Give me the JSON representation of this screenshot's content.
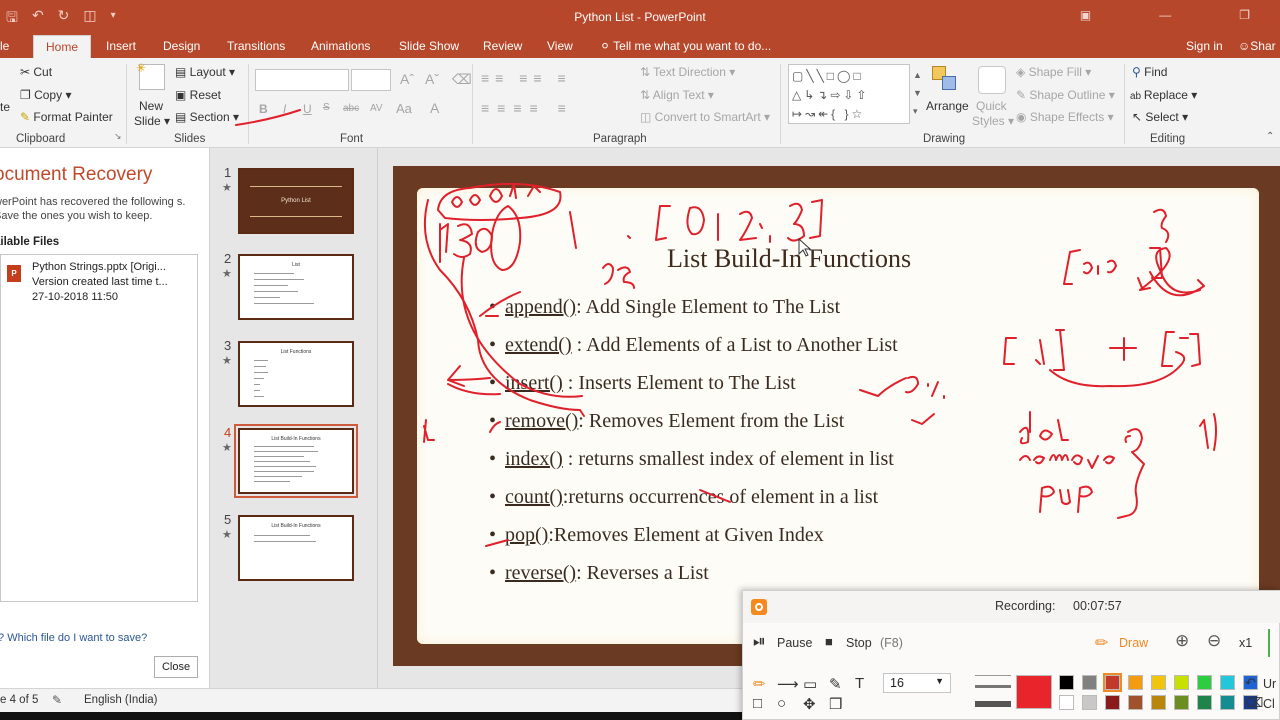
{
  "app": {
    "window_title": "Python List - PowerPoint",
    "qat_icons": [
      "save-icon",
      "undo-icon",
      "redo-icon",
      "present-icon",
      "customize-icon"
    ]
  },
  "tabs": [
    {
      "label": "le"
    },
    {
      "label": "Home"
    },
    {
      "label": "Insert"
    },
    {
      "label": "Design"
    },
    {
      "label": "Transitions"
    },
    {
      "label": "Animations"
    },
    {
      "label": "Slide Show"
    },
    {
      "label": "Review"
    },
    {
      "label": "View"
    }
  ],
  "tell_me": "Tell me what you want to do...",
  "signin": "Sign in",
  "share": "Shar",
  "ribbon": {
    "clipboard": {
      "cut": "Cut",
      "copy": "Copy",
      "format_painter": "Format Painter",
      "paste_partial": "te",
      "label": "Clipboard"
    },
    "slides": {
      "new_slide_1": "New",
      "new_slide_2": "Slide",
      "layout": "Layout",
      "reset": "Reset",
      "section": "Section",
      "label": "Slides"
    },
    "font": {
      "label": "Font",
      "bold": "B",
      "italic": "I",
      "underline": "U",
      "strike": "abc",
      "spacing": "AV"
    },
    "paragraph": {
      "text_direction": "Text Direction",
      "align_text": "Align Text",
      "convert_smartart": "Convert to SmartArt",
      "label": "Paragraph"
    },
    "drawing": {
      "arrange": "Arrange",
      "quick_1": "Quick",
      "quick_2": "Styles",
      "shape_fill": "Shape Fill",
      "shape_outline": "Shape Outline",
      "shape_effects": "Shape Effects",
      "label": "Drawing"
    },
    "editing": {
      "find": "Find",
      "replace": "Replace",
      "select": "Select",
      "label": "Editing"
    }
  },
  "recovery": {
    "title": "ocument Recovery",
    "desc": "werPoint has recovered the following s.  Save the ones you wish to keep.",
    "available": "ailable Files",
    "file": {
      "name": "Python Strings.pptx  [Origi...",
      "version": "Version created last time t...",
      "date": "27-10-2018 11:50"
    },
    "link": "Which file do I want to save?",
    "close": "Close"
  },
  "thumbnails": [
    {
      "num": "1",
      "title": "Python List"
    },
    {
      "num": "2",
      "title": "List"
    },
    {
      "num": "3",
      "title": "List Functions"
    },
    {
      "num": "4",
      "title": "List Build-In Functions"
    },
    {
      "num": "5",
      "title": "List Build-In Functions"
    }
  ],
  "slide": {
    "title": "List Build-In Functions",
    "bullets": [
      {
        "kw": "append()",
        "rest": ": Add Single Element to The List"
      },
      {
        "kw": "extend()",
        "rest": " : Add Elements of a List to Another List"
      },
      {
        "kw": "insert()",
        "rest": " : Inserts Element to The List"
      },
      {
        "kw": "remove()",
        "rest": ": Removes Element from the List"
      },
      {
        "kw": "index()",
        "rest": " : returns smallest index of element in list"
      },
      {
        "kw": "count()",
        "rest": ":returns occurrences of element in a list"
      },
      {
        "kw": "pop()",
        "rest": ":Removes Element at Given Index"
      },
      {
        "kw": "reverse()",
        "rest": ": Reverses a List"
      }
    ]
  },
  "status": {
    "slide_of": "e 4 of 5",
    "language": "English (India)"
  },
  "recorder": {
    "recording_label": "Recording:",
    "time": "00:07:57",
    "pause": "Pause",
    "stop": "Stop",
    "stop_key": "(F8)",
    "draw": "Draw",
    "zoom": "x1",
    "size": "16",
    "undo_partial": "Ur",
    "clear_partial": "Cl",
    "colors": [
      "#000000",
      "#808080",
      "#c0392b",
      "#f39c12",
      "#f1c40f",
      "#c8e000",
      "#2ecc40",
      "#26c6da",
      "#1e63d6",
      "#ffffff",
      "#c8c8c8",
      "#8b1a1a",
      "#a0522d",
      "#b8860b",
      "#6b8e23",
      "#1e8449",
      "#138d90",
      "#1a3a8a"
    ],
    "active_color": "#e8252a"
  }
}
